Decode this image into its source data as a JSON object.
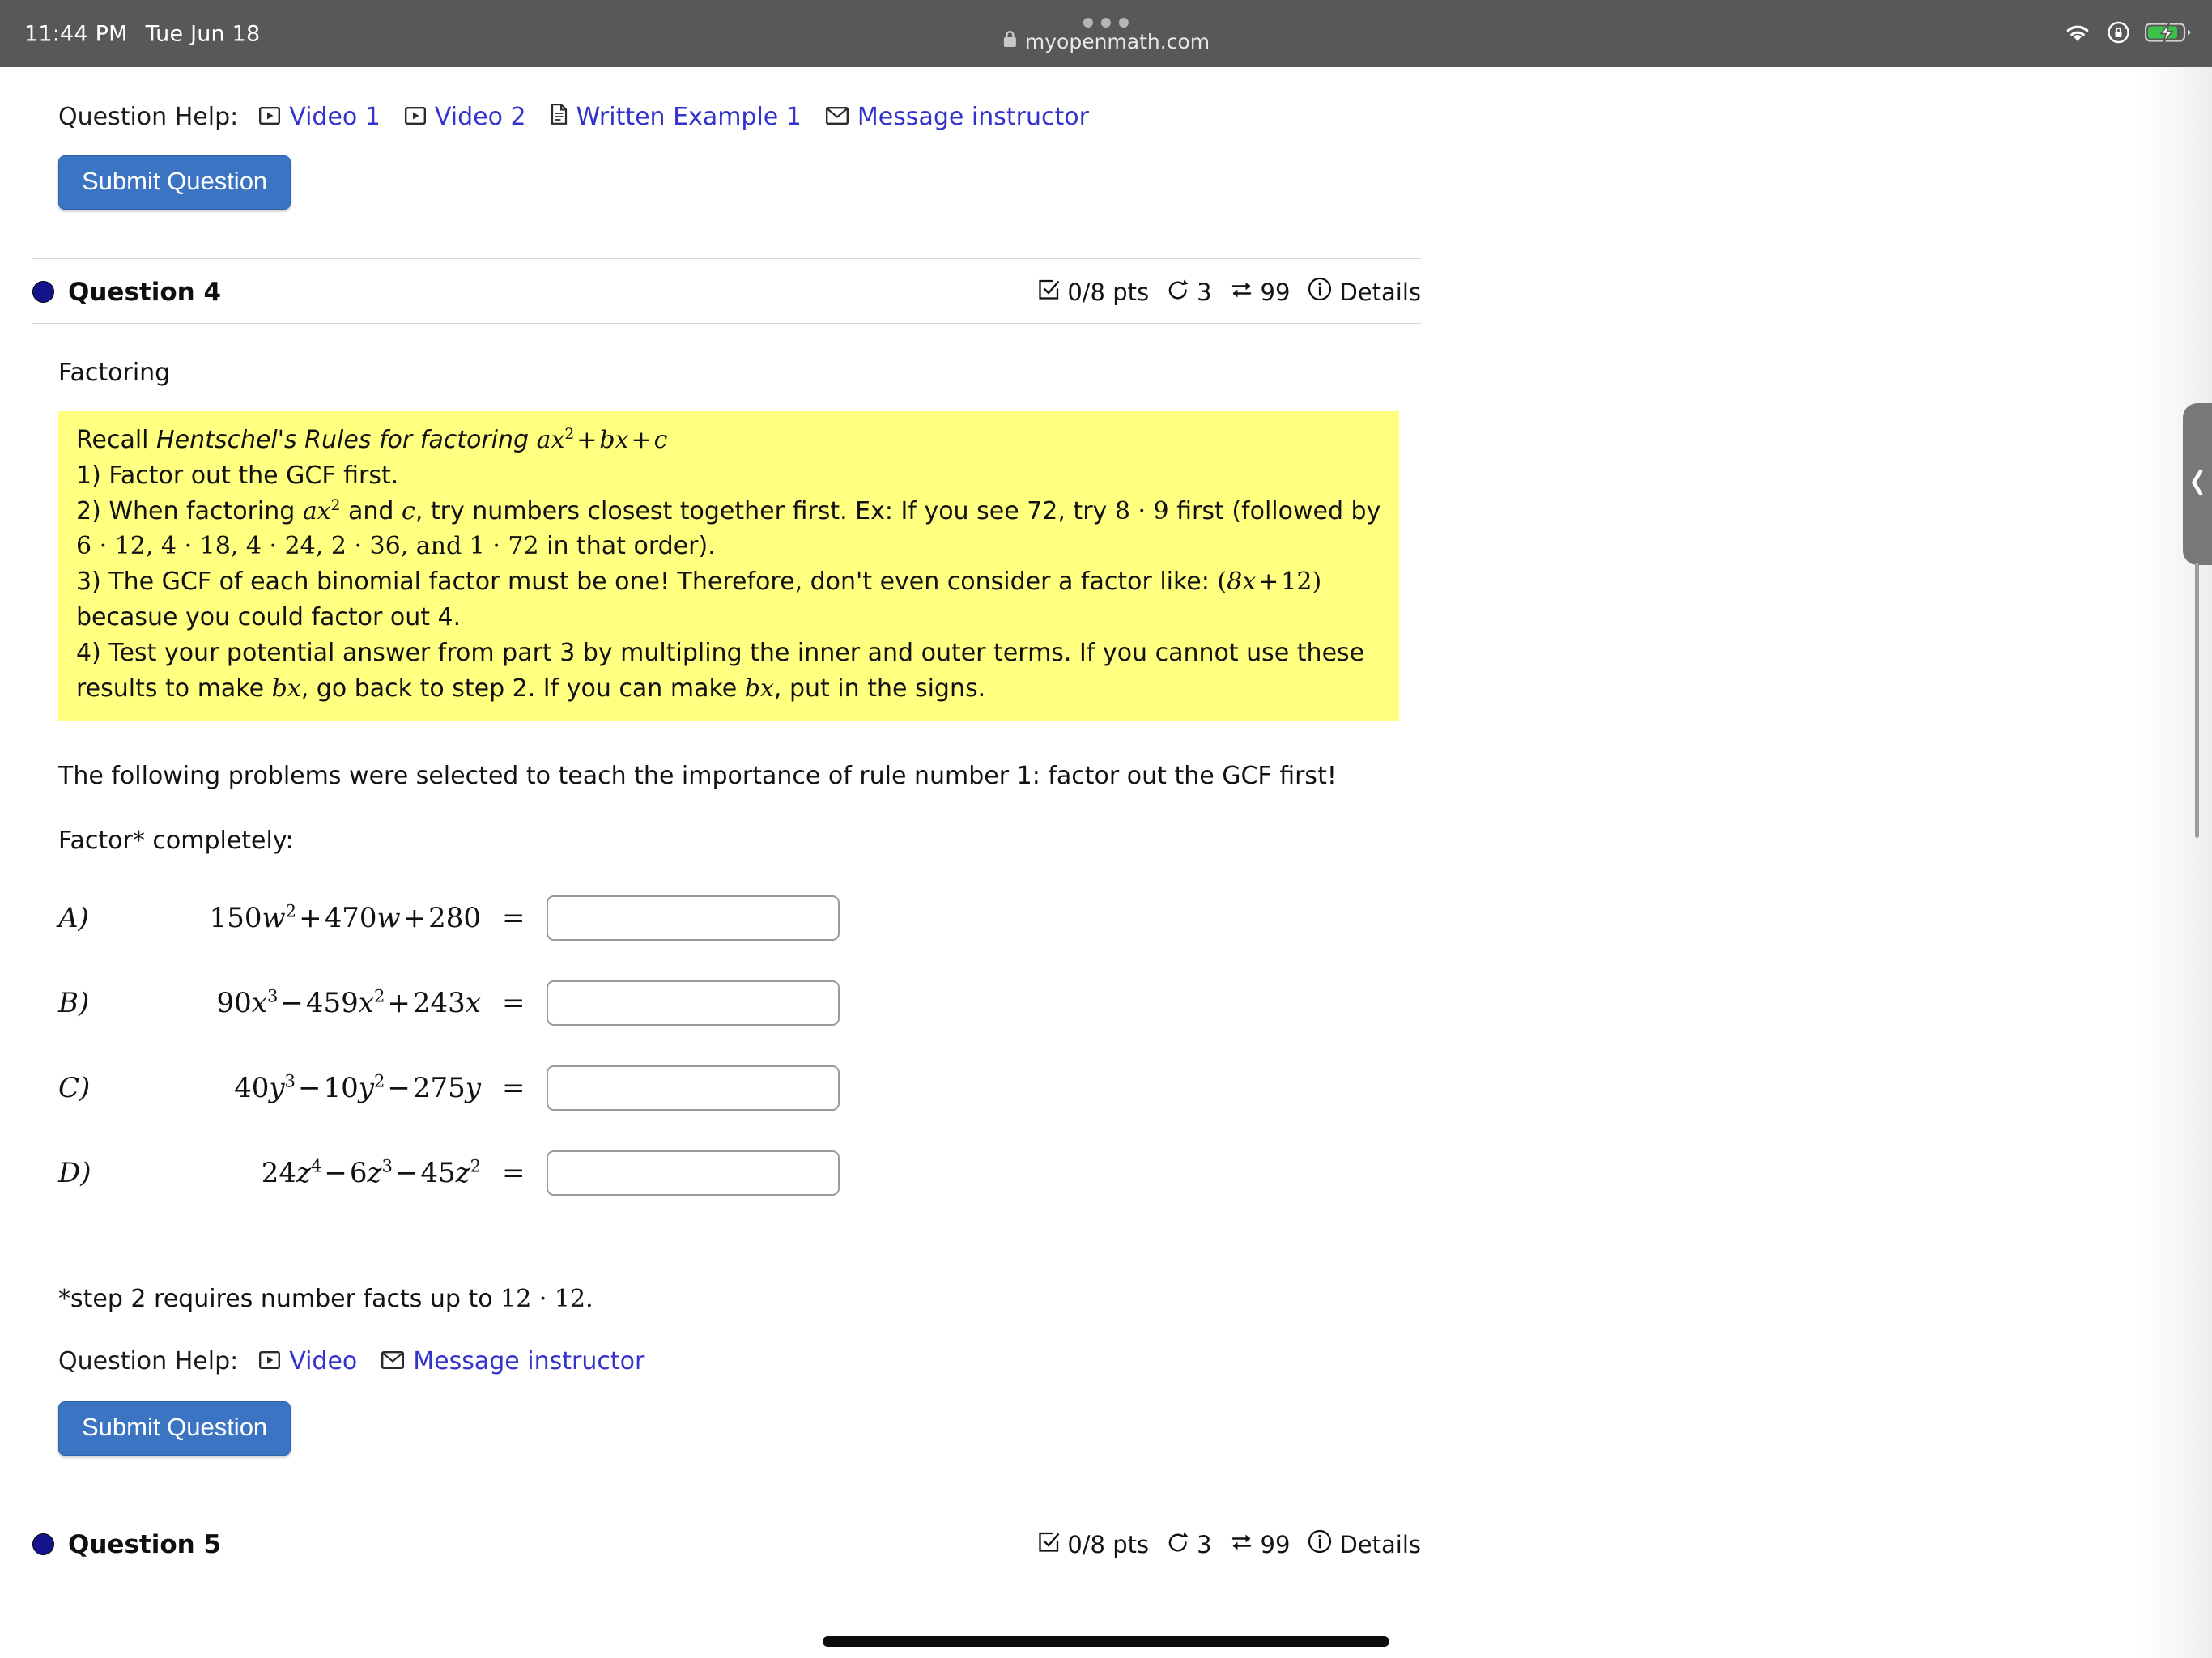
{
  "status_bar": {
    "time": "11:44 PM",
    "date": "Tue Jun 18",
    "url": "myopenmath.com",
    "lock_icon": "lock-icon",
    "wifi_icon": "wifi-icon",
    "rotation_lock_icon": "rotation-lock-icon",
    "battery_icon": "battery-charging-icon"
  },
  "question3": {
    "help_label": "Question Help:",
    "links": [
      {
        "label": "Video 1",
        "icon": "video-icon"
      },
      {
        "label": "Video 2",
        "icon": "video-icon"
      },
      {
        "label": "Written Example 1",
        "icon": "document-icon"
      },
      {
        "label": "Message instructor",
        "icon": "envelope-icon"
      }
    ],
    "submit_label": "Submit Question"
  },
  "question4": {
    "title": "Question 4",
    "points": "0/8 pts",
    "attempts": "3",
    "retries": "99",
    "details_label": "Details",
    "topic": "Factoring",
    "rules_box": {
      "heading_prefix": "Recall ",
      "heading_italic": "Hentschel's Rules for factoring ",
      "heading_math": "ax² + bx + c",
      "rule1": "1) Factor out the GCF first.",
      "rule2_a": "2) When factoring ",
      "rule2_math1": "ax²",
      "rule2_b": " and ",
      "rule2_math2": "c",
      "rule2_c": ", try numbers closest together first. Ex: If you see 72, try ",
      "rule2_math3": "8 · 9",
      "rule2_d": " first (followed by ",
      "rule2_math4": "6 · 12, 4 · 18, 4 · 24, 2 · 36,  and  1 · 72",
      "rule2_e": " in that order).",
      "rule3_a": "3) The GCF of each binomial factor must be one! Therefore, don't even consider a factor like: ",
      "rule3_math": "(8x + 12)",
      "rule3_b": "becasue you could factor out 4.",
      "rule4_a": "4) Test your potential answer from part 3 by multipling the inner and outer terms. If you cannot use these results to make ",
      "rule4_math1": "bx",
      "rule4_b": ", go back to step 2. If you can make ",
      "rule4_math2": "bx",
      "rule4_c": ", put in the signs."
    },
    "intro": "The following problems were selected to teach the importance of rule number 1: factor out the GCF first!",
    "instruction": "Factor* completely:",
    "problems": [
      {
        "label": "A)",
        "expression": "150w² + 470w + 280",
        "equals": "=",
        "answer": ""
      },
      {
        "label": "B)",
        "expression": "90x³ − 459x² + 243x",
        "equals": "=",
        "answer": ""
      },
      {
        "label": "C)",
        "expression": "40y³ − 10y² − 275y",
        "equals": "=",
        "answer": ""
      },
      {
        "label": "D)",
        "expression": "24z⁴ − 6z³ − 45z²",
        "equals": "=",
        "answer": ""
      }
    ],
    "footnote_a": "*step 2 requires number facts up to ",
    "footnote_math": "12 · 12.",
    "help_label": "Question Help:",
    "links": [
      {
        "label": "Video",
        "icon": "video-icon"
      },
      {
        "label": "Message instructor",
        "icon": "envelope-icon"
      }
    ],
    "submit_label": "Submit Question"
  },
  "question5": {
    "title": "Question 5",
    "points": "0/8 pts",
    "attempts": "3",
    "retries": "99",
    "details_label": "Details"
  },
  "colors": {
    "accent_link": "#3333cc",
    "button_blue": "#3c74c4",
    "highlight_yellow": "#ffff80",
    "bullet_navy": "#13138c",
    "statusbar_gray": "#585858"
  }
}
